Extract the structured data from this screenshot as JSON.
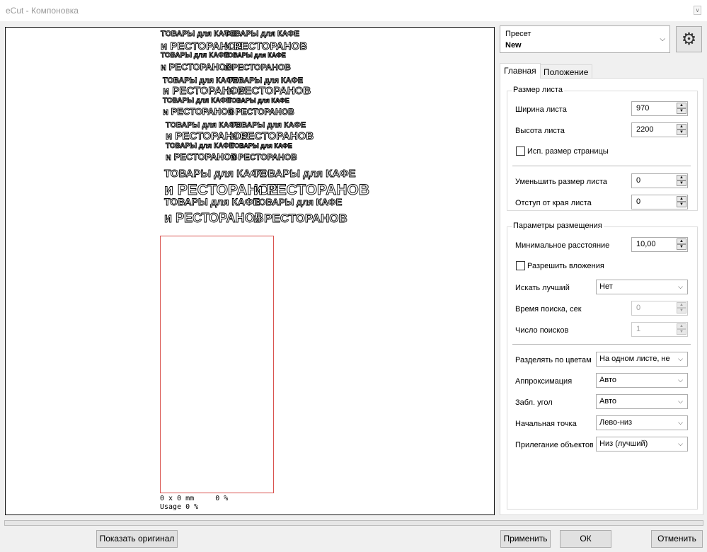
{
  "window": {
    "title": "eCut - Компоновка",
    "title_button_glyph": "∨"
  },
  "preview": {
    "lines": [
      {
        "row": 1,
        "col": 1,
        "text": "ТОВАРЫ для КАФЕ"
      },
      {
        "row": 1,
        "col": 2,
        "text": "ТОВАРЫ для КАФЕ"
      },
      {
        "row": 2,
        "col": 1,
        "text": "и РЕСТОРАНОВ"
      },
      {
        "row": 2,
        "col": 2,
        "text": "и РЕСТОРАНОВ"
      }
    ],
    "size_readout": "0 x 0 mm     0 %",
    "usage_readout": "Usage 0 %"
  },
  "preset": {
    "label": "Пресет",
    "value": "New"
  },
  "settings_button": {
    "icon": "gear-icon"
  },
  "tabs": [
    {
      "label": "Главная",
      "active": true
    },
    {
      "label": "Положение",
      "active": false
    }
  ],
  "sheet_size": {
    "group_title": "Размер листа",
    "width_label": "Ширина листа",
    "width_value": "970",
    "height_label": "Высота листа",
    "height_value": "2200",
    "use_page_size_label": "Исп. размер страницы",
    "use_page_size_checked": false,
    "shrink_label": "Уменьшить размер листа",
    "shrink_value": "0",
    "margin_label": "Отступ от края листа",
    "margin_value": "0"
  },
  "placement": {
    "group_title": "Параметры размещения",
    "min_distance_label": "Минимальное расстояние",
    "min_distance_value": "10,00",
    "allow_nesting_label": "Разрешить вложения",
    "allow_nesting_checked": false,
    "search_best_label": "Искать лучший",
    "search_best_value": "Нет",
    "search_time_label": "Время поиска, сек",
    "search_time_value": "0",
    "search_count_label": "Число поисков",
    "search_count_value": "1",
    "split_colors_label": "Разделять по цветам",
    "split_colors_value": "На одном листе, не с",
    "approximation_label": "Аппроксимация",
    "approximation_value": "Авто",
    "lock_angle_label": "Забл. угол",
    "lock_angle_value": "Авто",
    "start_point_label": "Начальная точка",
    "start_point_value": "Лево-низ",
    "object_fit_label": "Прилегание объектов",
    "object_fit_value": "Низ (лучший)"
  },
  "buttons": {
    "show_original": "Показать оригинал",
    "apply": "Применить",
    "ok": "ОК",
    "cancel": "Отменить"
  },
  "glyphs": {
    "dropdown_arrow": "⌵",
    "spin_up": "▲",
    "spin_down": "▼",
    "gear": "⚙"
  },
  "colors": {
    "sheet_outline": "#d9534f",
    "canvas_background": "#ffffff"
  }
}
